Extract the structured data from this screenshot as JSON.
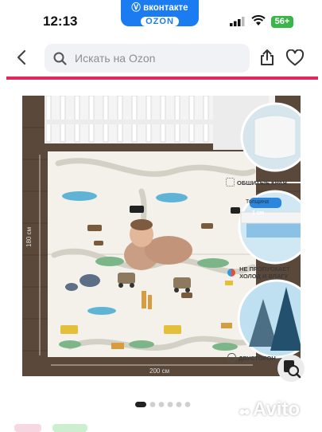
{
  "status": {
    "time": "12:13",
    "battery": "56+"
  },
  "banner": {
    "line1": "вконтакте",
    "line2": "OZON"
  },
  "search": {
    "placeholder": "Искать на Ozon"
  },
  "product": {
    "features": {
      "edges": "ОБШИТЫЕ КРАЯ",
      "thickness_title": "Толщина",
      "thickness_value": "1 см",
      "insulation_line1": "НЕ ПРОПУСКАЕТ",
      "insulation_line2": "ХОЛОД И ВЛАГУ",
      "double_sided": "ДВУСТОРОН"
    },
    "dimensions": {
      "height": "180 см",
      "width": "200 см"
    }
  },
  "gallery": {
    "total_dots": 6,
    "active_index": 0
  },
  "watermark": "Avito",
  "colors": {
    "accent": "#e0285e",
    "vk_blue": "#1a7cf0",
    "battery": "#39b54a"
  }
}
